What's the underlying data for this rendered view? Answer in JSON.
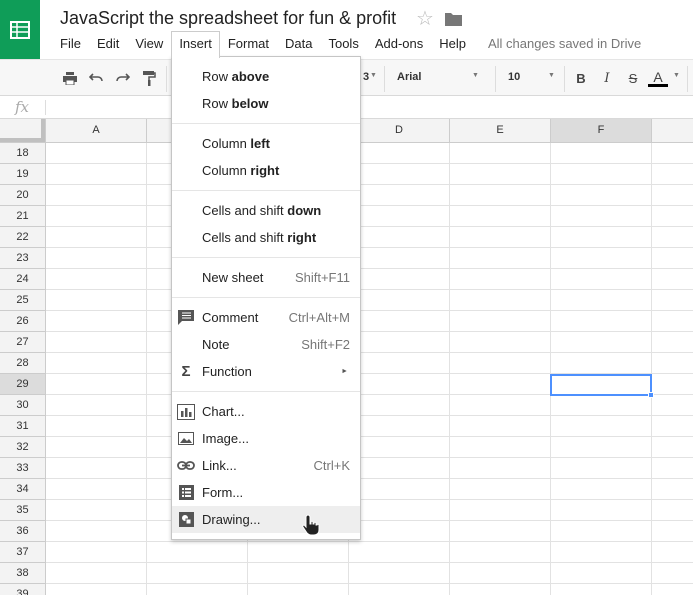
{
  "doc": {
    "title": "JavaScript the spreadsheet for fun & profit",
    "save_status": "All changes saved in Drive",
    "brand_color": "#0f9d58"
  },
  "menubar": [
    "File",
    "Edit",
    "View",
    "Insert",
    "Format",
    "Data",
    "Tools",
    "Add-ons",
    "Help"
  ],
  "toolbar": {
    "font": "Arial",
    "font_size": "10",
    "number_format_fragment": "3",
    "bold": "B",
    "italic": "I",
    "strike": "S",
    "text_color": "A"
  },
  "formula_bar": {
    "fx": "fx",
    "value": ""
  },
  "grid": {
    "columns": [
      "A",
      "",
      "",
      "D",
      "E",
      "F"
    ],
    "rows": [
      "18",
      "19",
      "20",
      "21",
      "22",
      "23",
      "24",
      "25",
      "26",
      "27",
      "28",
      "29",
      "30",
      "31",
      "32",
      "33",
      "34",
      "35",
      "36",
      "37",
      "38",
      "39"
    ],
    "selected_column": "F",
    "selected_row": "29"
  },
  "insert_menu": {
    "row_above": {
      "pre": "Row ",
      "bold": "above"
    },
    "row_below": {
      "pre": "Row ",
      "bold": "below"
    },
    "column_left": {
      "pre": "Column ",
      "bold": "left"
    },
    "column_right": {
      "pre": "Column ",
      "bold": "right"
    },
    "cells_down": {
      "pre": "Cells and shift ",
      "bold": "down"
    },
    "cells_right": {
      "pre": "Cells and shift ",
      "bold": "right"
    },
    "new_sheet": {
      "label": "New sheet",
      "shortcut": "Shift+F11"
    },
    "comment": {
      "label": "Comment",
      "shortcut": "Ctrl+Alt+M",
      "icon": "comment-icon"
    },
    "note": {
      "label": "Note",
      "shortcut": "Shift+F2"
    },
    "function": {
      "label": "Function",
      "icon": "sigma-icon"
    },
    "chart": {
      "label": "Chart...",
      "icon": "chart-icon"
    },
    "image": {
      "label": "Image...",
      "icon": "image-icon"
    },
    "link": {
      "label": "Link...",
      "shortcut": "Ctrl+K",
      "icon": "link-icon"
    },
    "form": {
      "label": "Form...",
      "icon": "form-icon"
    },
    "drawing": {
      "label": "Drawing...",
      "icon": "drawing-icon"
    }
  }
}
